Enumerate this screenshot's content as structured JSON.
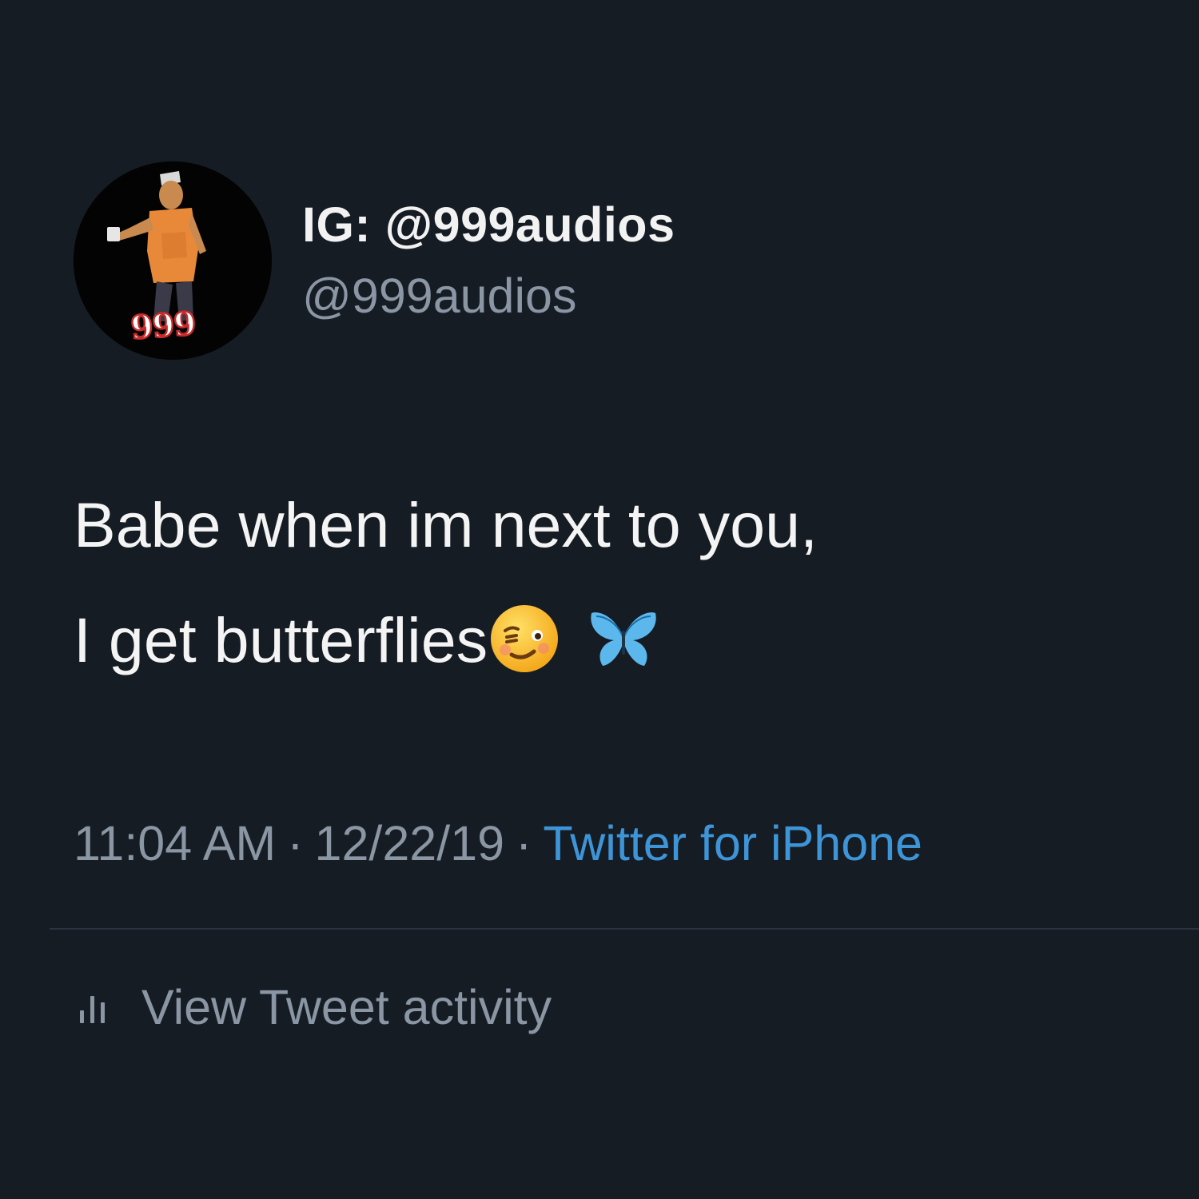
{
  "header": {
    "display_name": "IG: @999audios",
    "handle": "@999audios",
    "avatar_icon": "avatar-999-cartoon",
    "avatar_badge_text": "999"
  },
  "tweet": {
    "lines": [
      "Babe when im next to you,",
      "I get butterflies"
    ],
    "emojis": [
      "woozy-face-emoji",
      "blue-butterfly-emoji"
    ]
  },
  "meta": {
    "time": "11:04 AM",
    "date": "12/22/19",
    "separator": "·",
    "source": "Twitter for iPhone"
  },
  "activity": {
    "label": "View Tweet activity",
    "icon": "bar-chart-icon"
  },
  "colors": {
    "background": "#161c24",
    "primary_text": "#f4f4f4",
    "secondary_text": "#8a96a3",
    "link": "#3d95d8"
  }
}
